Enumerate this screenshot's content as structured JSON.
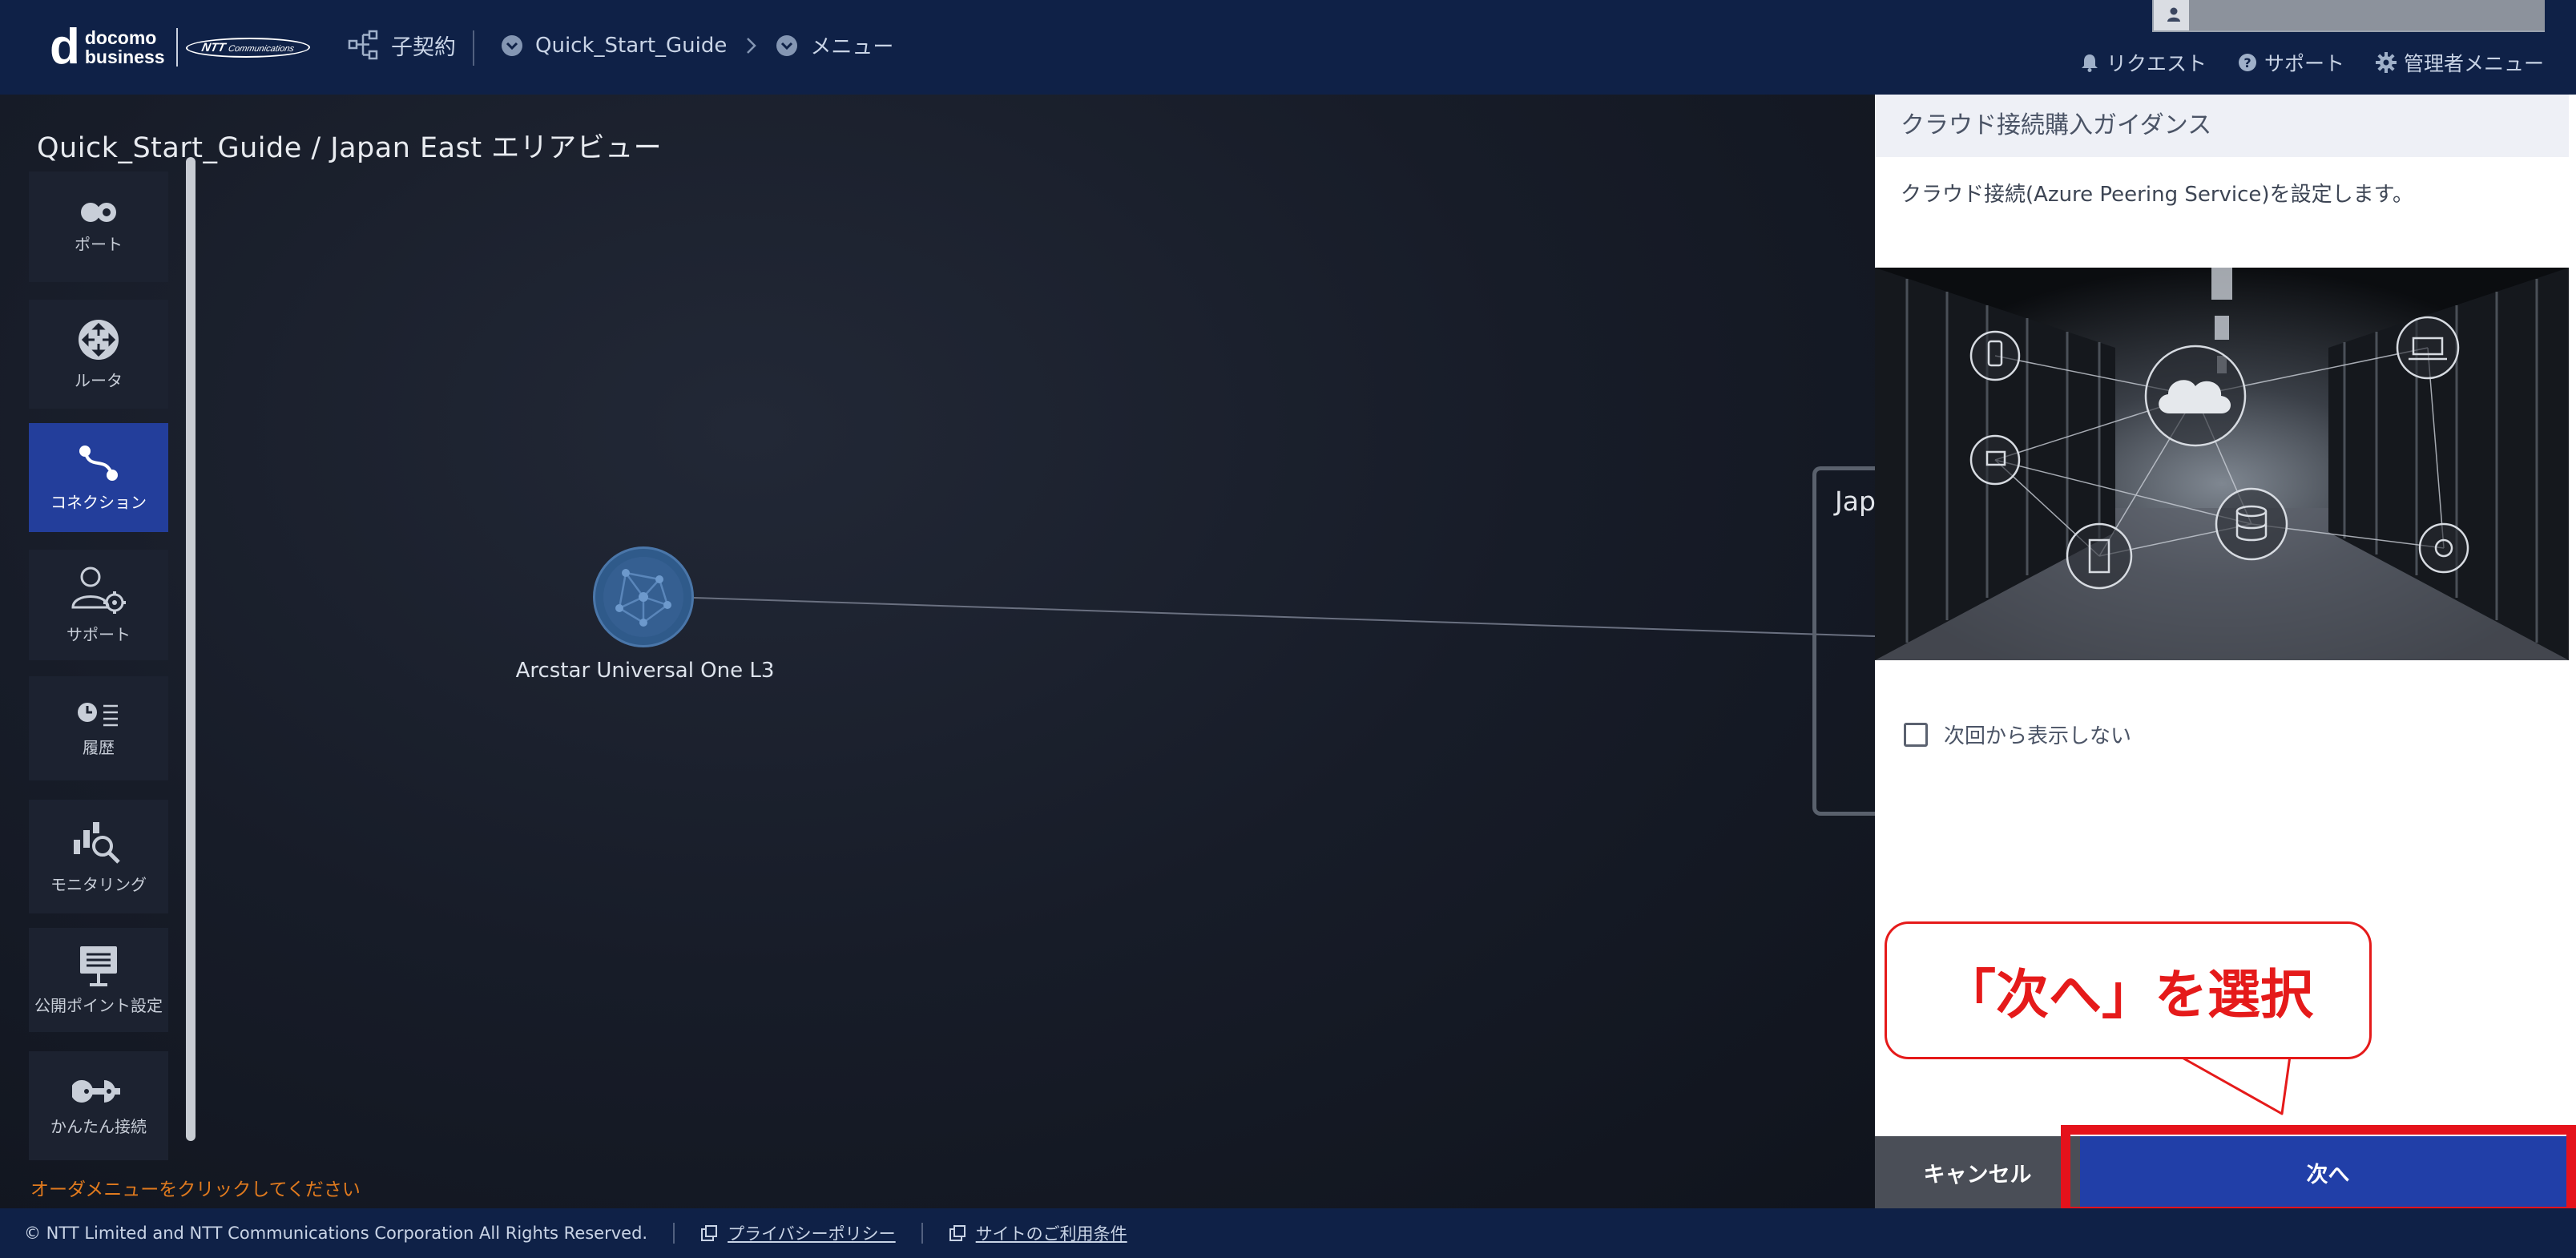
{
  "header": {
    "brand": {
      "mark": "d",
      "line1": "docomo",
      "line2": "business",
      "ntt_logo": "NTT",
      "ntt_logo_sub": "Communications"
    },
    "nav": [
      {
        "label": "子契約",
        "icon": "hierarchy-icon"
      },
      {
        "label": "Quick_Start_Guide",
        "icon": "chevron-circle-icon"
      },
      {
        "label": "メニュー",
        "icon": "chevron-circle-icon"
      }
    ],
    "links": {
      "request": "リクエスト",
      "support": "サポート",
      "admin": "管理者メニュー"
    }
  },
  "page": {
    "title": "Quick_Start_Guide / Japan East エリアビュー"
  },
  "sidebar": {
    "items": [
      {
        "label": "ポート",
        "icon": "port-icon"
      },
      {
        "label": "ルータ",
        "icon": "router-icon"
      },
      {
        "label": "コネクション",
        "icon": "connection-icon",
        "active": true
      },
      {
        "label": "サポート",
        "icon": "user-gear-icon"
      },
      {
        "label": "履歴",
        "icon": "history-icon"
      },
      {
        "label": "モニタリング",
        "icon": "monitoring-icon"
      },
      {
        "label": "公開ポイント設定",
        "icon": "board-icon"
      },
      {
        "label": "かんたん接続",
        "icon": "plug-icon"
      }
    ]
  },
  "canvas": {
    "node_label": "Arcstar Universal One L3",
    "area_label": "Jap",
    "order_hint": "オーダメニューをクリックしてください"
  },
  "dialog": {
    "title": "クラウド接続購入ガイダンス",
    "description": "クラウド接続(Azure Peering Service)を設定します。",
    "checkbox_label": "次回から表示しない",
    "cancel_label": "キャンセル",
    "next_label": "次へ"
  },
  "annotation": {
    "callout": "「次へ」を選択",
    "color": "#e51a1a"
  },
  "footer": {
    "copyright": "© NTT Limited and NTT Communications Corporation All Rights Reserved.",
    "privacy": "プライバシーポリシー",
    "terms": "サイトのご利用条件"
  },
  "colors": {
    "header_bg": "#0f2147",
    "active": "#233e9b",
    "next_button": "#213fa8",
    "cancel_button": "#4a4e57"
  }
}
